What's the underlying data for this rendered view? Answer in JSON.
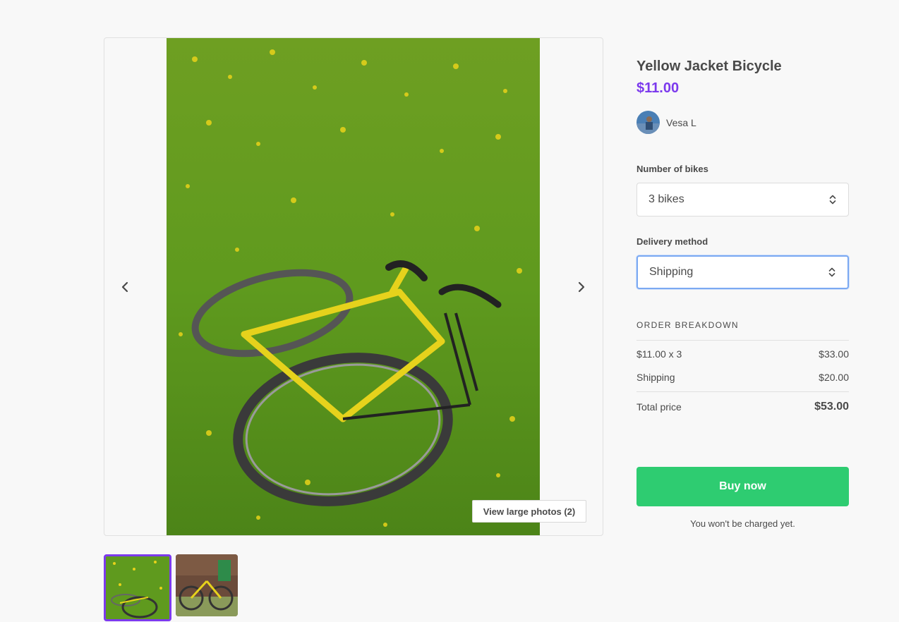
{
  "gallery": {
    "view_large_label": "View large photos (2)",
    "prev_icon": "chevron-left-icon",
    "next_icon": "chevron-right-icon",
    "selected_thumb_color": "#7c3aed"
  },
  "listing": {
    "title": "Yellow Jacket Bicycle",
    "price": "$11.00",
    "price_color": "#7c3aed",
    "author_name": "Vesa L"
  },
  "form": {
    "quantity_label": "Number of bikes",
    "quantity_value": "3 bikes",
    "delivery_label": "Delivery method",
    "delivery_value": "Shipping"
  },
  "breakdown": {
    "heading": "ORDER BREAKDOWN",
    "line_item_label": "$11.00 x 3",
    "line_item_value": "$33.00",
    "shipping_label": "Shipping",
    "shipping_value": "$20.00",
    "total_label": "Total price",
    "total_value": "$53.00"
  },
  "actions": {
    "buy_label": "Buy now",
    "buy_color": "#2ecc71",
    "note": "You won't be charged yet."
  }
}
